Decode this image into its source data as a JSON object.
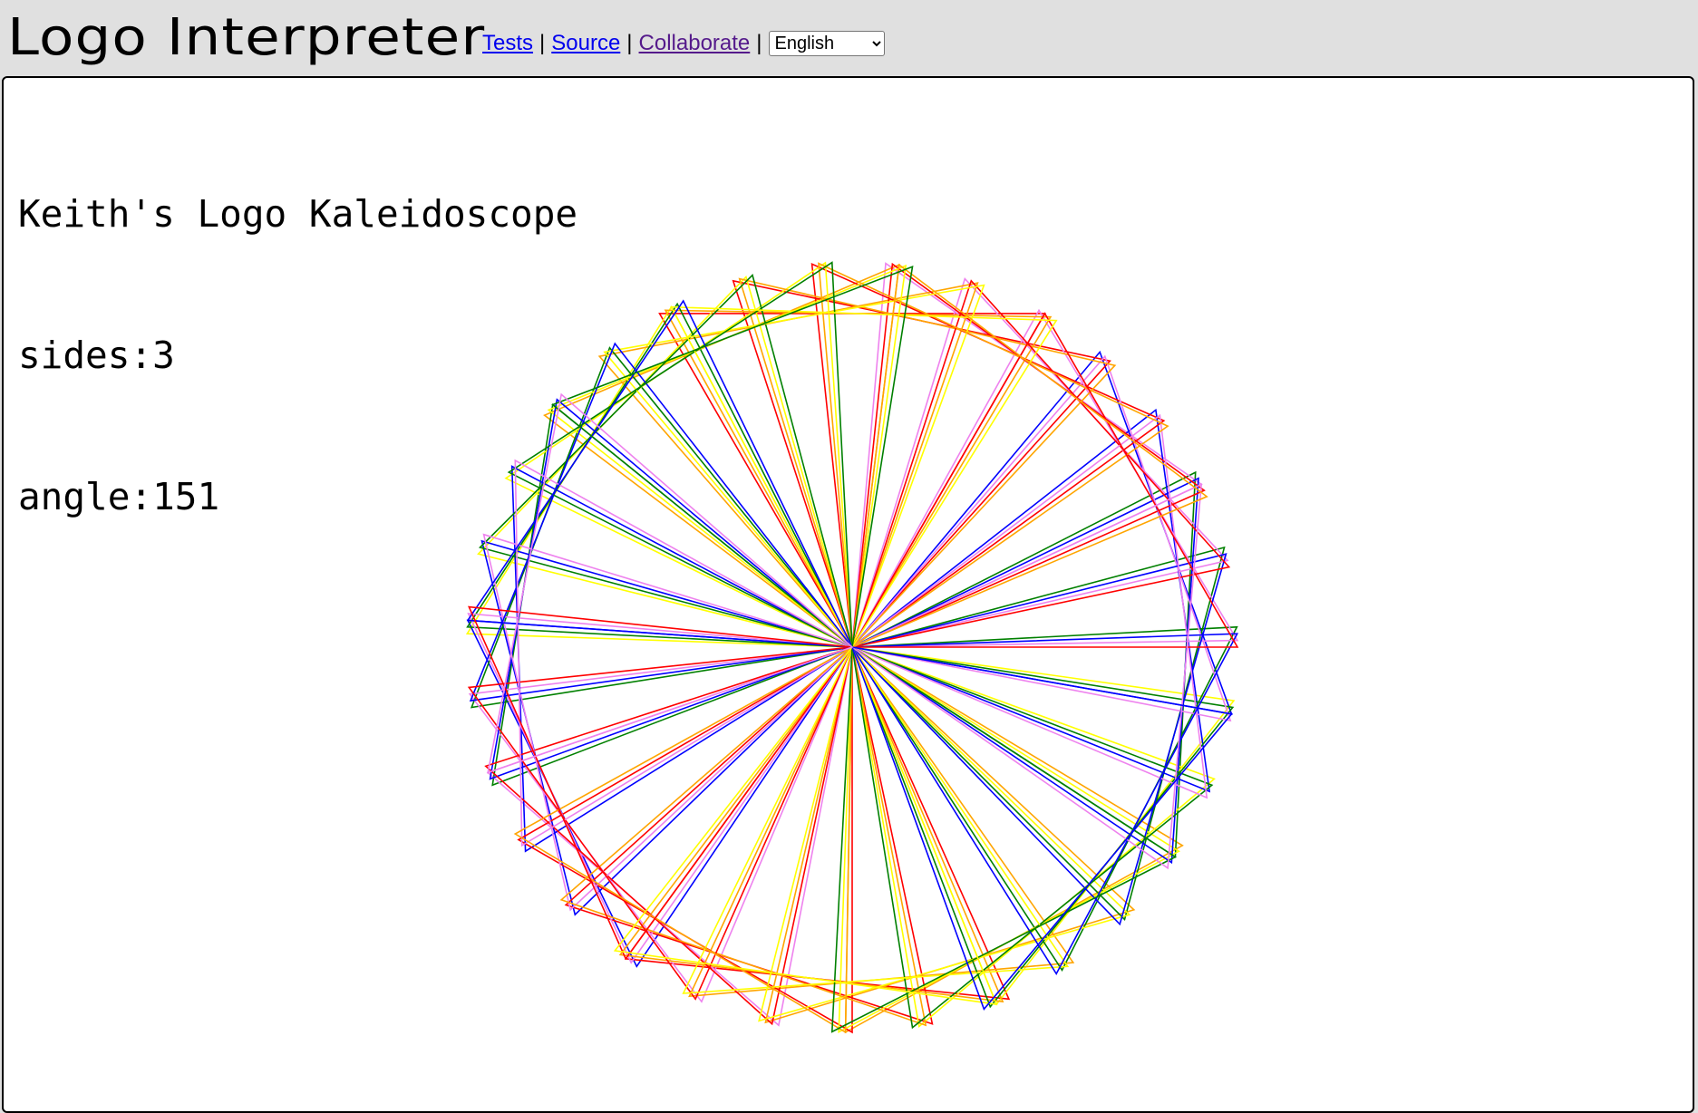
{
  "header": {
    "title": "Logo Interpreter",
    "links": [
      {
        "label": "Tests"
      },
      {
        "label": "Source"
      },
      {
        "label": "Collaborate"
      }
    ],
    "separator": "|",
    "language": {
      "selected": "English"
    }
  },
  "output": {
    "lines": [
      "Keith's Logo Kaleidoscope",
      "sides:3",
      "angle:151"
    ]
  },
  "drawing": {
    "sides": 3,
    "angle": 151,
    "colors": [
      "#ff0000",
      "#ffa500",
      "#ffff00",
      "#008000",
      "#0000ff",
      "#ee82ee"
    ]
  }
}
